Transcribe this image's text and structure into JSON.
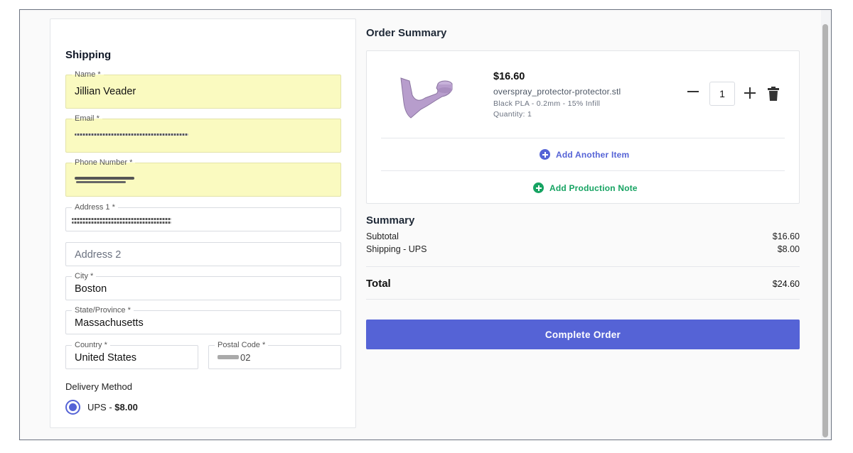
{
  "shipping": {
    "title": "Shipping",
    "name": {
      "label": "Name",
      "required": "*",
      "value": "Jillian Veader"
    },
    "email": {
      "label": "Email",
      "required": "*"
    },
    "phone": {
      "label": "Phone Number",
      "required": "*"
    },
    "address1": {
      "label": "Address 1",
      "required": "*"
    },
    "address2": {
      "placeholder": "Address 2"
    },
    "city": {
      "label": "City",
      "required": "*",
      "value": "Boston"
    },
    "state": {
      "label": "State/Province",
      "required": "*",
      "value": "Massachusetts"
    },
    "country": {
      "label": "Country",
      "required": "*",
      "value": "United States"
    },
    "postal": {
      "label": "Postal Code",
      "required": "*",
      "value_visible": "02"
    },
    "delivery_label": "Delivery Method",
    "delivery_option": {
      "carrier": "UPS",
      "separator": " - ",
      "price": "$8.00",
      "selected": true
    }
  },
  "order": {
    "title": "Order Summary",
    "item": {
      "price": "$16.60",
      "file_name": "overspray_protector-protector.stl",
      "spec": "Black PLA - 0.2mm - 15% Infill",
      "quantity_text": "Quantity: 1",
      "quantity_value": "1",
      "thumbnail_color": "#b79dcc"
    },
    "add_item_label": "Add Another Item",
    "add_note_label": "Add Production Note"
  },
  "summary": {
    "title": "Summary",
    "subtotal_label": "Subtotal",
    "subtotal_value": "$16.60",
    "shipping_label": "Shipping - UPS",
    "shipping_value": "$8.00",
    "total_label": "Total",
    "total_value": "$24.60"
  },
  "actions": {
    "complete_order": "Complete Order"
  },
  "colors": {
    "accent": "#5563d6",
    "success": "#16a362",
    "autofill": "#fafac0"
  }
}
